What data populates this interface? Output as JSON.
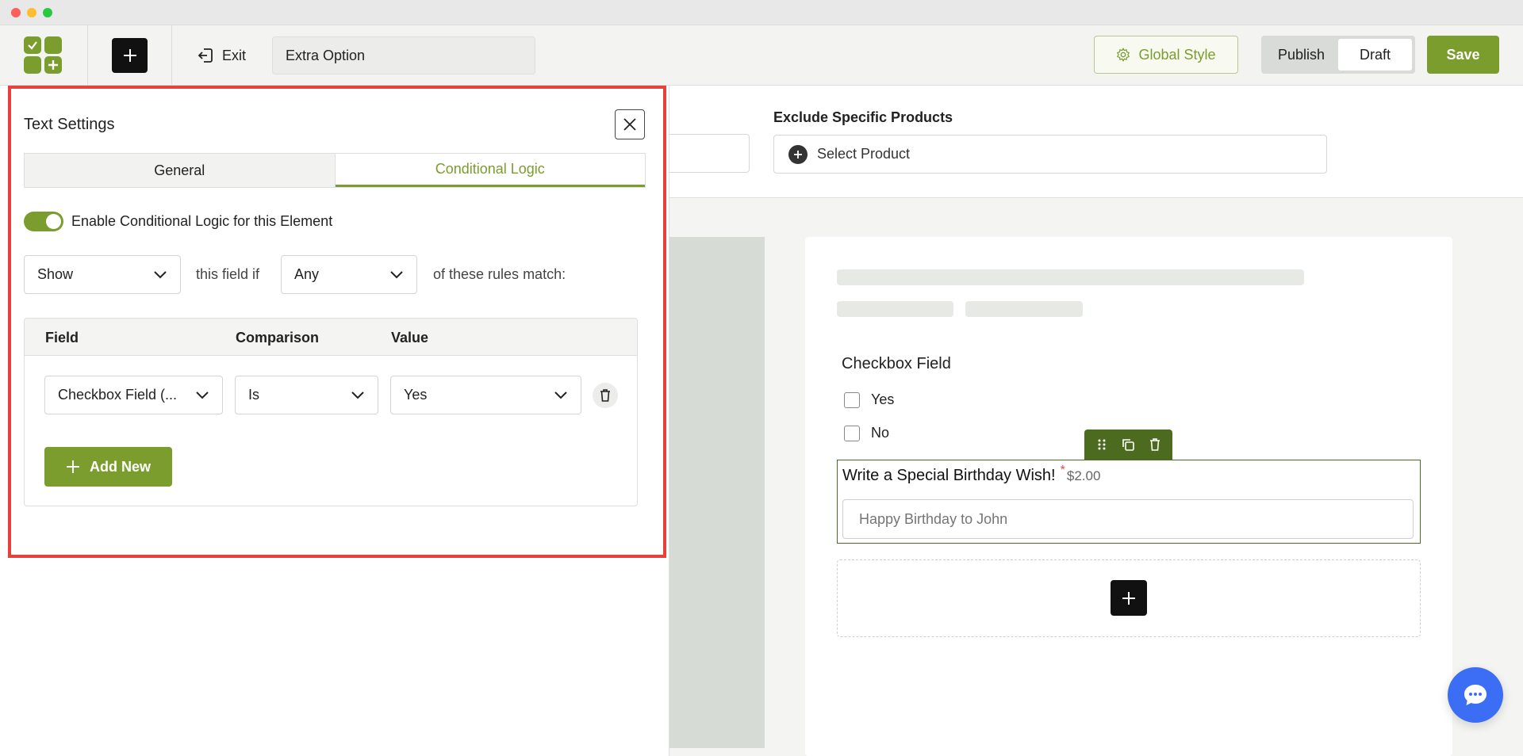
{
  "toolbar": {
    "exit_label": "Exit",
    "option_name_value": "Extra Option",
    "global_style_label": "Global Style",
    "publish_label": "Publish",
    "draft_label": "Draft",
    "save_label": "Save"
  },
  "background": {
    "exclude_label": "Exclude Specific Products",
    "select_product_label": "Select Product"
  },
  "preview": {
    "checkbox_title": "Checkbox Field",
    "checkbox_options": [
      "Yes",
      "No"
    ],
    "text_label": "Write a Special Birthday Wish!",
    "required_mark": "*",
    "price": "$2.00",
    "text_placeholder": "Happy Birthday to John"
  },
  "panel": {
    "title": "Text Settings",
    "tabs": [
      "General",
      "Conditional Logic"
    ],
    "active_tab": "Conditional Logic",
    "enable_label": "Enable Conditional Logic for this Element",
    "enabled": true,
    "action_value": "Show",
    "middle_text": "this field if",
    "match_value": "Any",
    "tail_text": "of these rules match:",
    "columns": [
      "Field",
      "Comparison",
      "Value"
    ],
    "rule": {
      "field": "Checkbox Field (...",
      "comparison": "Is",
      "value": "Yes"
    },
    "add_new_label": "Add New"
  },
  "colors": {
    "accent": "#7a9d2d",
    "highlight": "#e8413c",
    "chat": "#3b6ef5"
  }
}
